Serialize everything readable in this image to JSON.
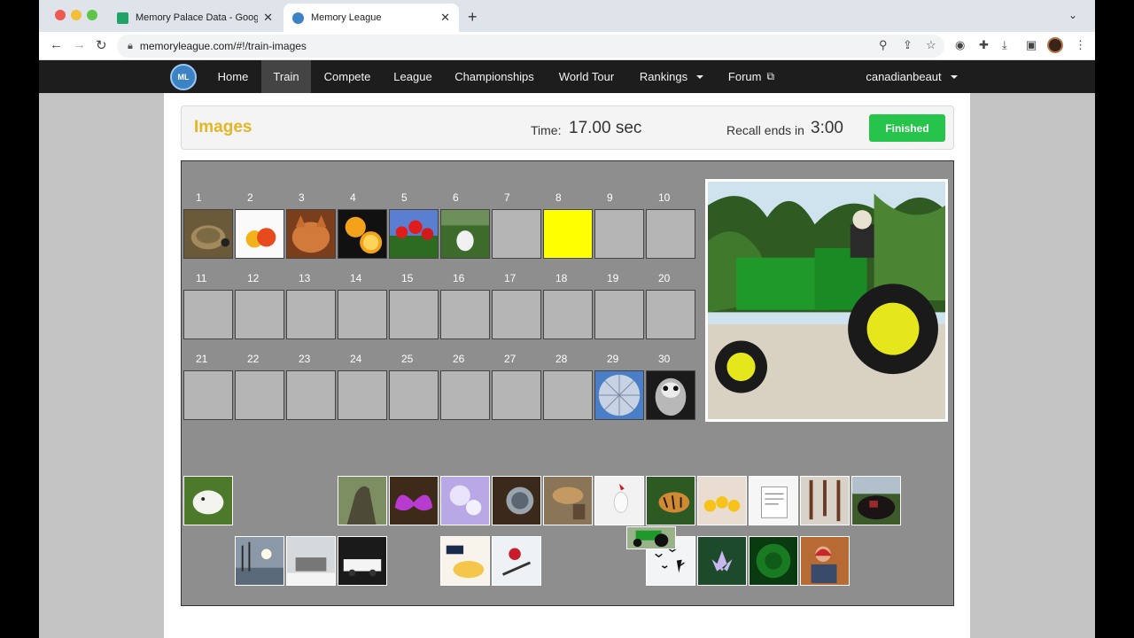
{
  "browser": {
    "tabs": [
      {
        "title": "Memory Palace Data - Google",
        "icon": "google-sheets-icon",
        "active": false
      },
      {
        "title": "Memory League",
        "icon": "memory-league-favicon",
        "active": true
      }
    ],
    "url": "memoryleague.com/#!/train-images"
  },
  "site": {
    "logo_text": "MEMORY LEAGUE",
    "nav": [
      {
        "label": "Home",
        "active": false
      },
      {
        "label": "Train",
        "active": true
      },
      {
        "label": "Compete",
        "active": false
      },
      {
        "label": "League",
        "active": false
      },
      {
        "label": "Championships",
        "active": false
      },
      {
        "label": "World Tour",
        "active": false
      },
      {
        "label": "Rankings",
        "active": false,
        "dropdown": true
      },
      {
        "label": "Forum",
        "active": false,
        "external": true
      }
    ],
    "user": "canadianbeaut"
  },
  "header": {
    "title": "Images",
    "time_label": "Time:",
    "time_value": "17.00 sec",
    "recall_label": "Recall ends in",
    "recall_value": "3:00",
    "finished_label": "Finished"
  },
  "grid": {
    "numbers": [
      "1",
      "2",
      "3",
      "4",
      "5",
      "6",
      "7",
      "8",
      "9",
      "10",
      "11",
      "12",
      "13",
      "14",
      "15",
      "16",
      "17",
      "18",
      "19",
      "20",
      "21",
      "22",
      "23",
      "24",
      "25",
      "26",
      "27",
      "28",
      "29",
      "30"
    ],
    "slots": [
      "tortoise",
      "apples",
      "orange-cat",
      "orange-slices",
      "red-tulips",
      "white-dog",
      "",
      "highlighted",
      "",
      "",
      "",
      "",
      "",
      "",
      "",
      "",
      "",
      "",
      "",
      "",
      "",
      "",
      "",
      "",
      "",
      "",
      "",
      "",
      "parachute",
      "falcon"
    ]
  },
  "preview_image": "green-tractor",
  "pool_row_1": [
    "hamster",
    "",
    "",
    "lizard",
    "butterfly-wings",
    "bubble-light",
    "coconut-ball",
    "hat-still-life",
    "chicken",
    "tiger-fern",
    "rubber-ducks",
    "paper-notes",
    "hanging-herbs",
    "black-bull"
  ],
  "pool_row_2": [
    "",
    "lake-trees",
    "car-snow",
    "sports-car",
    "",
    "dessert",
    "bmx-rider",
    "",
    "",
    "birds-sky",
    "water-lily",
    "green-tunnel",
    "old-woman"
  ],
  "dragging": "green-tractor-small",
  "colors": {
    "accent": "#e5b624",
    "finished_green": "#27c44c",
    "highlight_slot": "#ffff00",
    "board_gray": "#8e8e8e",
    "nav_bg": "#1d1d1d"
  }
}
